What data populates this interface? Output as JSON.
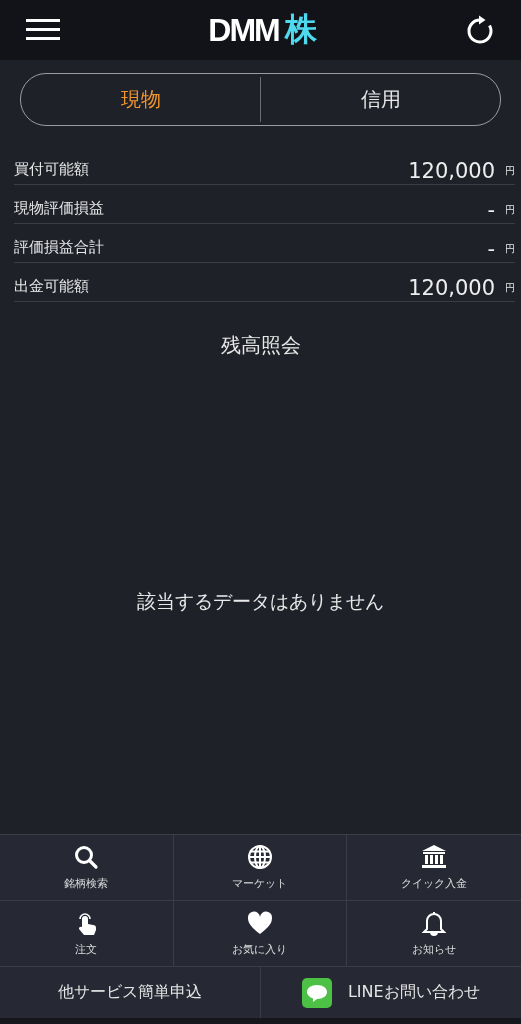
{
  "header": {
    "logo": {
      "latin": "DMM",
      "kanji": "株"
    }
  },
  "tabs": [
    {
      "label": "現物",
      "selected": true
    },
    {
      "label": "信用",
      "selected": false
    }
  ],
  "summary": [
    {
      "label": "買付可能額",
      "value": "120,000",
      "unit": "円"
    },
    {
      "label": "現物評価損益",
      "value": "-",
      "unit": "円"
    },
    {
      "label": "評価損益合計",
      "value": "-",
      "unit": "円"
    },
    {
      "label": "出金可能額",
      "value": "120,000",
      "unit": "円"
    }
  ],
  "section_title": "残高照会",
  "empty_message": "該当するデータはありません",
  "menu": [
    {
      "kind": "search",
      "label": "銘柄検索"
    },
    {
      "kind": "globe",
      "label": "マーケット"
    },
    {
      "kind": "bank",
      "label": "クイック入金"
    },
    {
      "kind": "hand",
      "label": "注文"
    },
    {
      "kind": "heart",
      "label": "お気に入り"
    },
    {
      "kind": "bell",
      "label": "お知らせ"
    }
  ],
  "footer_links": [
    {
      "kind": "plain",
      "label": "他サービス簡単申込"
    },
    {
      "kind": "line",
      "label": "LINEお問い合わせ"
    }
  ]
}
